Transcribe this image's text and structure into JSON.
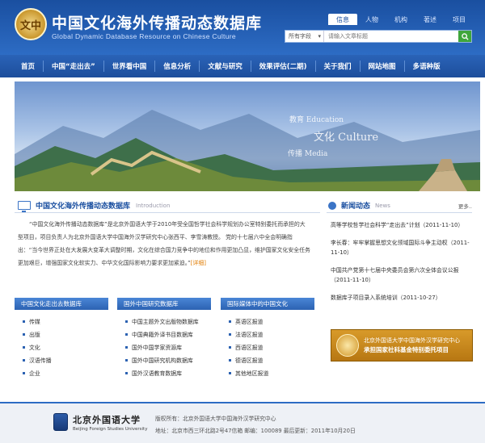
{
  "header": {
    "logo_text": "文中",
    "title": "中国文化海外传播动态数据库",
    "subtitle": "Global Dynamic Database Resource on Chinese Culture",
    "search_tabs": [
      "信息",
      "人物",
      "机构",
      "著述",
      "项目"
    ],
    "search_field": "所有字段",
    "search_placeholder": "请输入文章标题"
  },
  "nav": {
    "items": [
      "首页",
      "中国“走出去”",
      "世界看中国",
      "信息分析",
      "文献与研究",
      "效果评估(二期)",
      "关于我们",
      "网站地图",
      "多语种版"
    ]
  },
  "banner": {
    "words": [
      "教育 Education",
      "文化 Culture",
      "传播 Media"
    ]
  },
  "intro": {
    "title": "中国文化海外传播动态数据库",
    "title_en": "Introduction",
    "text": "“中国文化海外传播动态数据库”是北京外国语大学于2010年受全国哲学社会科学规划办公室特别委托而承担的大型项目，项目负责人为北京外国语大学中国海外汉学研究中心张西平、李雪涛教授。 党的十七届六中全会明确指出：“当今世界正处在大发展大变革大调整时期，文化在综合国力竞争中的地位和作用更加凸显，维护国家文化安全任务更加艰巨，增强国家文化软实力、中华文化国际影响力要求更加紧迫。”",
    "more": "[详细]"
  },
  "columns": [
    {
      "title": "中国文化走出去数据库",
      "items": [
        "传媒",
        "出版",
        "文化",
        "汉语传播",
        "企业"
      ]
    },
    {
      "title": "国外中国研究数据库",
      "items": [
        "中国主题外文出版物数据库",
        "中国典籍外译书目数据库",
        "国外中国学家资源库",
        "国外中国研究机构数据库",
        "国外汉语教育数据库"
      ]
    },
    {
      "title": "国际媒体中的中国文化",
      "items": [
        "英语区报道",
        "法语区报道",
        "西语区报道",
        "德语区报道",
        "其他地区报道"
      ]
    }
  ],
  "news": {
    "title": "新闻动态",
    "title_en": "News",
    "more": "更多..",
    "items": [
      "高等学校哲学社会科学“走出去”计划（2011-11-10）",
      "李长春：牢牢掌握思想文化领域国际斗争主动权（2011-11-10）",
      "中国共产党第十七届中央委员会第六次全体会议公报（2011-11-10）",
      "数据库子项目录入系统培训（2011-10-27）"
    ]
  },
  "promo": {
    "line1": "北京外国语大学中国海外汉学研究中心",
    "line2": "承担国家社科基金特别委托项目"
  },
  "footer": {
    "univ_name": "北京外国语大学",
    "univ_en": "Beijing Foreign Studies University",
    "line1": "版权所有：北京外国语大学中国海外汉学研究中心",
    "line2": "地址：北京市西三环北路2号47信箱  邮编：100089    最后更新：2011年10月20日"
  }
}
